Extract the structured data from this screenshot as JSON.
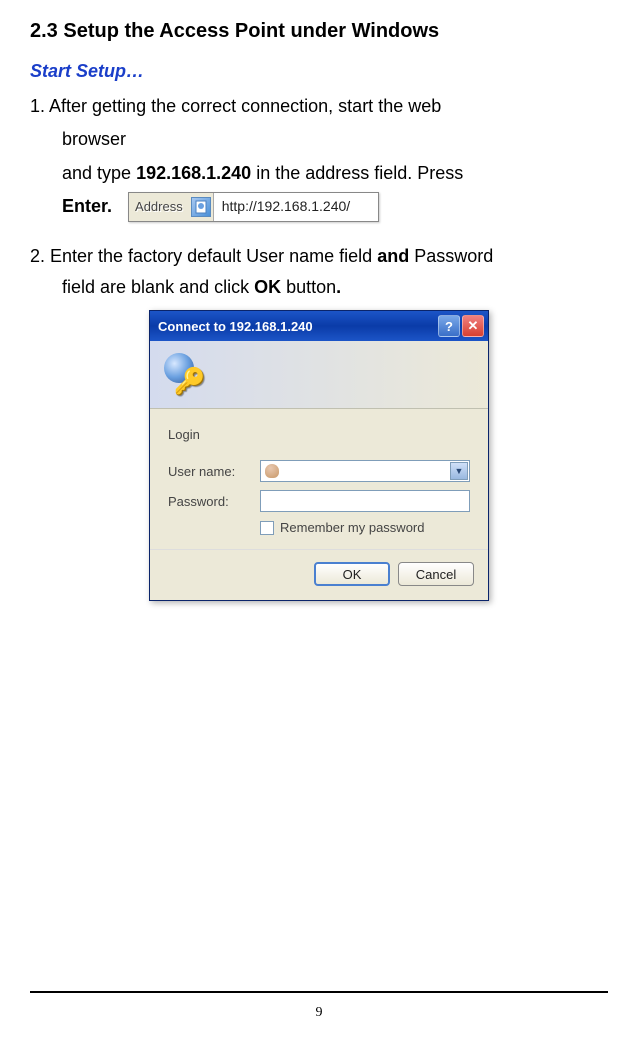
{
  "section": {
    "heading": "2.3    Setup the Access Point under Windows",
    "subheading": "Start Setup…"
  },
  "step1": {
    "prefix": "1.  After getting the correct connection, start the web",
    "line2": "browser",
    "line3_pre": "and type ",
    "ip": "192.168.1.240",
    "line3_post": " in the address field.  Press",
    "enter": "Enter."
  },
  "address_bar": {
    "label": "Address",
    "url": "http://192.168.1.240/"
  },
  "step2": {
    "prefix": " 2.  Enter the factory default User name field ",
    "and": "and",
    "mid": " Password",
    "line2_pre": "field are blank and click ",
    "ok": "OK",
    "line2_post": " button",
    "dot": "."
  },
  "dialog": {
    "title": "Connect to 192.168.1.240",
    "login_label": "Login",
    "username_label": "User name:",
    "username_value": "",
    "password_label": "Password:",
    "password_value": "",
    "remember_label": "Remember my password",
    "ok_button": "OK",
    "cancel_button": "Cancel"
  },
  "page_number": "9"
}
